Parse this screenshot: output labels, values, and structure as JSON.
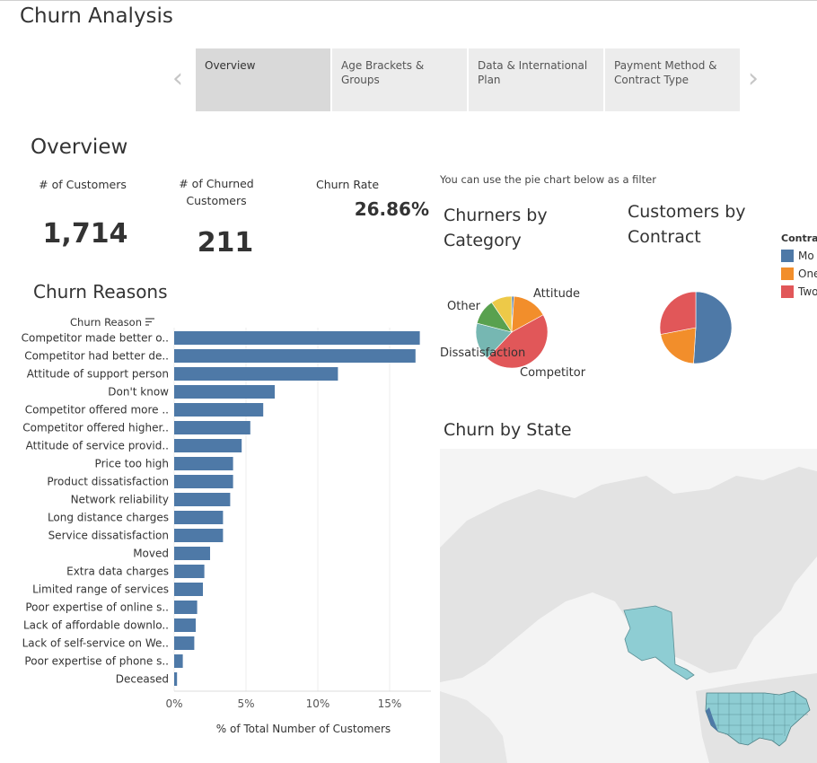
{
  "app": {
    "title": "Churn Analysis"
  },
  "tabs": [
    {
      "label": "Overview",
      "active": true
    },
    {
      "label": "Age Brackets & Groups",
      "active": false
    },
    {
      "label": "Data & International Plan",
      "active": false
    },
    {
      "label": "Payment Method & Contract Type",
      "active": false
    }
  ],
  "nav": {
    "prev_icon": "chevron-left-icon",
    "next_icon": "chevron-right-icon",
    "prev_glyph": "‹",
    "next_glyph": "›"
  },
  "overview": {
    "title": "Overview",
    "customers_label": "# of Customers",
    "customers_value": "1,714",
    "churned_label_line1": "# of Churned",
    "churned_label_line2": "Customers",
    "churned_value": "211",
    "churn_rate_label": "Churn Rate",
    "churn_rate_value": "26.86%"
  },
  "hint": "You can use the pie chart below as a filter",
  "churn_reasons": {
    "title": "Churn Reasons",
    "column_header": "Churn Reason",
    "sort_icon": "sort-icon",
    "bar_color": "#4e79a7",
    "x_axis_title": "% of Total Number of Customers",
    "x_ticks": [
      "0%",
      "5%",
      "10%",
      "15%"
    ]
  },
  "category_pie": {
    "title_line1": "Churners by",
    "title_line2": "Category"
  },
  "contract_pie": {
    "title_line1": "Customers by",
    "title_line2": "Contract"
  },
  "contract_legend": {
    "title": "Contrac",
    "items": [
      {
        "label": "Mo",
        "color": "#4e79a7"
      },
      {
        "label": "One",
        "color": "#f28e2b"
      },
      {
        "label": "Two",
        "color": "#e15759"
      }
    ]
  },
  "state_map": {
    "title": "Churn by State",
    "fill_color": "#8ecdd3",
    "land_color": "#e3e3e3"
  },
  "chart_data": [
    {
      "type": "bar",
      "orientation": "horizontal",
      "categories": [
        "Competitor made better o..",
        "Competitor had better de..",
        "Attitude of support person",
        "Don't know",
        "Competitor offered more ..",
        "Competitor offered higher..",
        "Attitude of service provid..",
        "Price too high",
        "Product dissatisfaction",
        "Network reliability",
        "Long distance charges",
        "Service dissatisfaction",
        "Moved",
        "Extra data charges",
        "Limited range of services",
        "Poor expertise of online s..",
        "Lack of affordable downlo..",
        "Lack of self-service on We..",
        "Poor expertise of phone s..",
        "Deceased"
      ],
      "values": [
        17.1,
        16.8,
        11.4,
        7.0,
        6.2,
        5.3,
        4.7,
        4.1,
        4.1,
        3.9,
        3.4,
        3.4,
        2.5,
        2.1,
        2.0,
        1.6,
        1.5,
        1.4,
        0.6,
        0.2
      ],
      "xlabel": "% of Total Number of Customers",
      "ylabel": "Churn Reason",
      "xlim": [
        0,
        18
      ],
      "grid": true
    },
    {
      "type": "pie",
      "title": "Churners by Category",
      "labels": [
        "",
        "Attitude",
        "Competitor",
        "Dissatisfaction",
        "Other"
      ],
      "values": [
        1,
        16,
        45,
        17,
        21
      ],
      "colors": [
        "#4e79a7",
        "#f28e2b",
        "#e15759",
        "#76b7b2",
        "#59a14f"
      ],
      "extra_colors": [
        "#edc948"
      ]
    },
    {
      "type": "pie",
      "title": "Customers by Contract",
      "labels": [
        "Mo",
        "One",
        "Two"
      ],
      "values": [
        51,
        21,
        28
      ],
      "colors": [
        "#4e79a7",
        "#f28e2b",
        "#e15759"
      ]
    }
  ]
}
